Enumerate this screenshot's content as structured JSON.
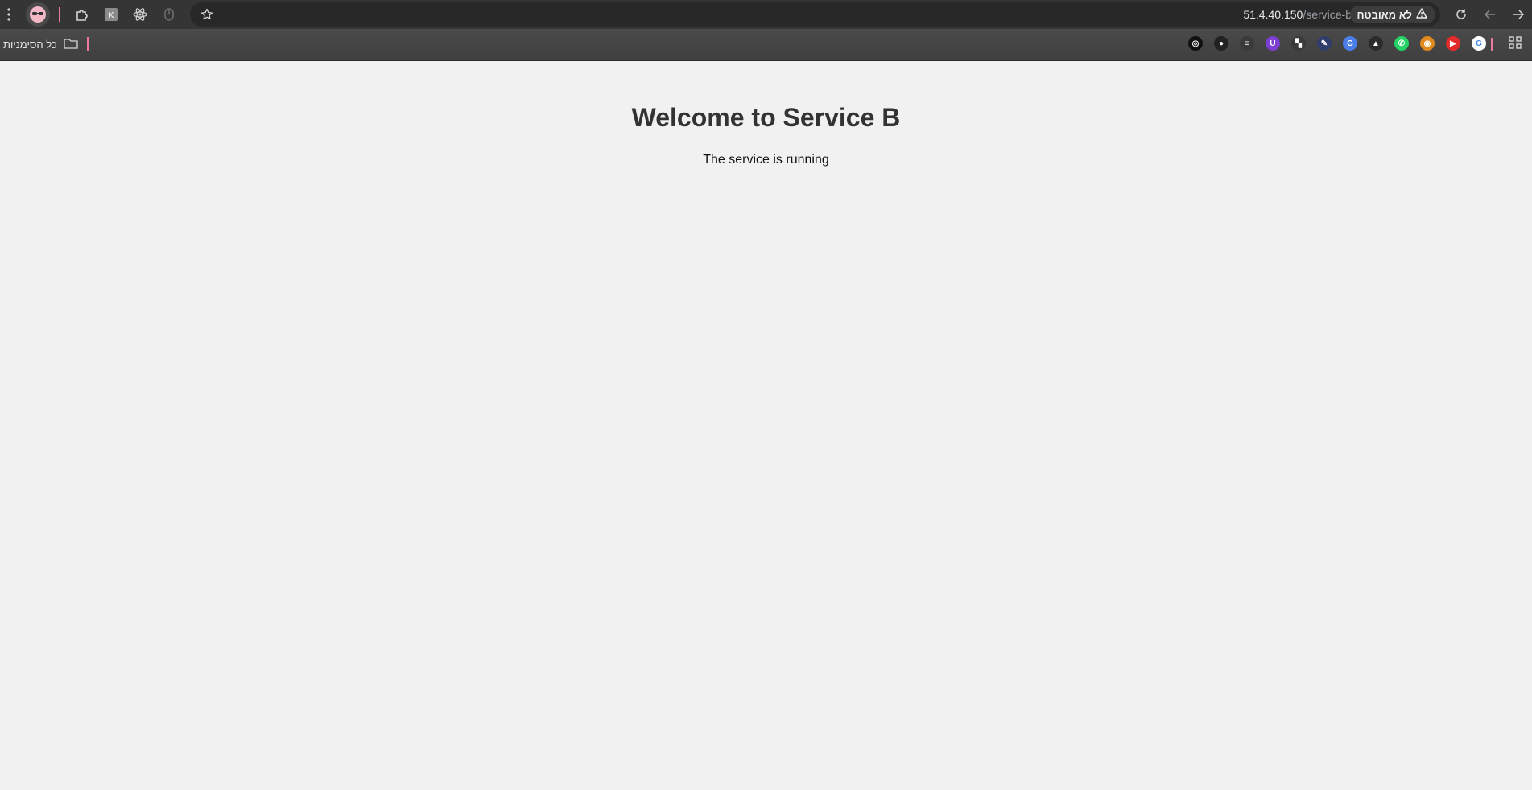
{
  "toolbar": {
    "url_host": "51.4.40.150",
    "url_path": "/service-b",
    "security_label": "לא מאובטח",
    "icons": [
      "menu-icon",
      "profile-avatar",
      "extensions-icon",
      "extension-k-icon",
      "react-devtools-icon",
      "mouse-extension-icon",
      "bookmark-star-icon",
      "reload-icon",
      "back-icon",
      "forward-icon",
      "warning-icon"
    ]
  },
  "bookmarks_bar": {
    "all_bookmarks_label": "כל הסימניות",
    "items": [
      {
        "name": "openai",
        "glyph": "◎",
        "color": "#111111"
      },
      {
        "name": "github",
        "glyph": "●",
        "color": "#222222"
      },
      {
        "name": "stackoverflow",
        "glyph": "≡",
        "color": "#3a3a3a"
      },
      {
        "name": "udemy",
        "glyph": "Ü",
        "color": "#7b3fd1"
      },
      {
        "name": "gitlab",
        "glyph": "▚",
        "color": "#3a3a3a"
      },
      {
        "name": "tool",
        "glyph": "✎",
        "color": "#2f3d6b"
      },
      {
        "name": "translate",
        "glyph": "G",
        "color": "#4a7de8"
      },
      {
        "name": "drive",
        "glyph": "▲",
        "color": "#2b2b2b"
      },
      {
        "name": "whatsapp",
        "glyph": "✆",
        "color": "#25d366"
      },
      {
        "name": "medal",
        "glyph": "◉",
        "color": "#e08a1e"
      },
      {
        "name": "youtube",
        "glyph": "▶",
        "color": "#e22b2b"
      },
      {
        "name": "google",
        "glyph": "G",
        "color": "#ffffff"
      }
    ]
  },
  "page": {
    "title": "Welcome to Service B",
    "subtitle": "The service is running"
  }
}
